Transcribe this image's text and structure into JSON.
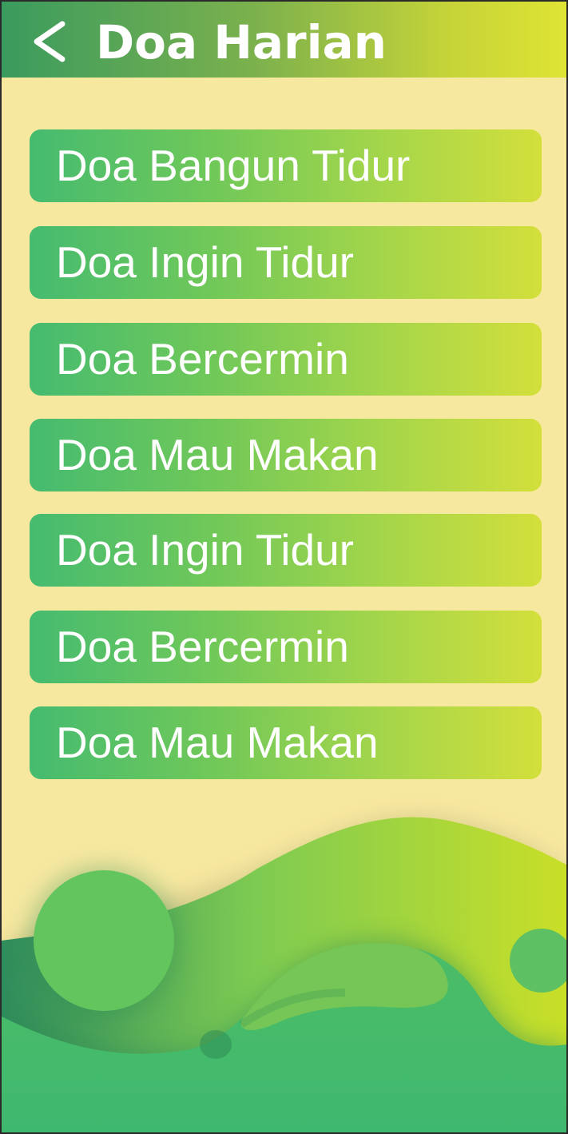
{
  "header": {
    "title": "Doa Harian",
    "back_icon": "chevron-left-icon"
  },
  "menu": {
    "items": [
      {
        "label": "Doa Bangun Tidur"
      },
      {
        "label": "Doa Ingin Tidur"
      },
      {
        "label": "Doa Bercermin"
      },
      {
        "label": "Doa Mau Makan"
      },
      {
        "label": "Doa Ingin Tidur"
      },
      {
        "label": "Doa Bercermin"
      },
      {
        "label": "Doa Mau Makan"
      }
    ]
  },
  "colors": {
    "background": "#f7e8a0",
    "header_start": "#3a9b5e",
    "header_end": "#dfe434",
    "item_start": "#45bb70",
    "item_end": "#d3df3b",
    "text": "#ffffff"
  }
}
